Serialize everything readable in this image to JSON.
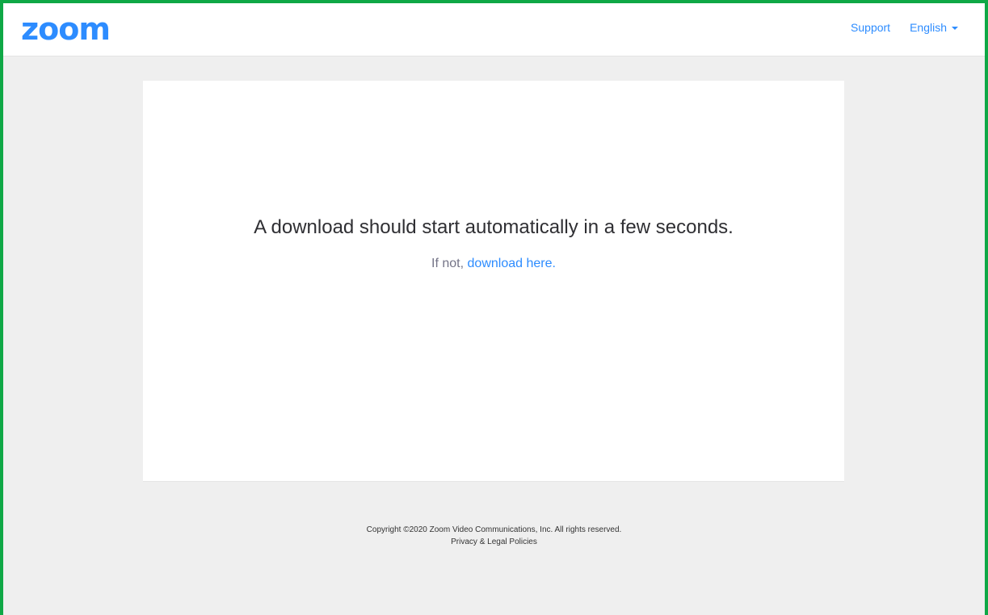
{
  "header": {
    "logo_text": "zoom",
    "support_label": "Support",
    "language_label": "English"
  },
  "main": {
    "headline": "A download should start automatically in a few seconds.",
    "fallback_prefix": "If not, ",
    "fallback_link": "download here."
  },
  "footer": {
    "copyright": "Copyright ©2020 Zoom Video Communications, Inc. All rights reserved.",
    "policies_link": "Privacy & Legal Policies"
  },
  "colors": {
    "brand_blue": "#2d8cff",
    "page_background": "#efefef",
    "frame_border": "#0fa846"
  }
}
